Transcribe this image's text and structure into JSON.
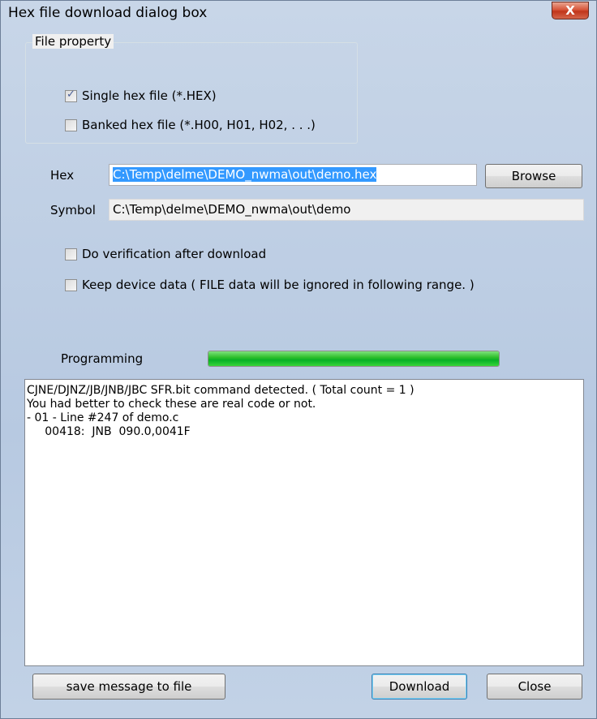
{
  "window": {
    "title": "Hex file download dialog box",
    "close_glyph": "X"
  },
  "file_property": {
    "group_label": "File property",
    "single_hex": {
      "label": "Single hex file (*.HEX)",
      "checked": true
    },
    "banked_hex": {
      "label": "Banked hex file (*.H00, H01, H02, . . .)",
      "checked": false
    }
  },
  "hex": {
    "label": "Hex",
    "value": "C:\\Temp\\delme\\DEMO_nwma\\out\\demo.hex",
    "browse_label": "Browse"
  },
  "symbol": {
    "label": "Symbol",
    "value": "C:\\Temp\\delme\\DEMO_nwma\\out\\demo"
  },
  "options": {
    "verify": {
      "label": "Do verification after download",
      "checked": false
    },
    "keep": {
      "label": "Keep device data ( FILE data will be ignored in following range. )",
      "checked": false
    }
  },
  "programming": {
    "label": "Programming",
    "progress": 1.0
  },
  "log": {
    "lines": [
      "CJNE/DJNZ/JB/JNB/JBC SFR.bit command detected. ( Total count = 1 )",
      "You had better to check these are real code or not.",
      "",
      "- 01 - Line #247 of demo.c",
      "     00418:  JNB  090.0,0041F"
    ]
  },
  "buttons": {
    "save": "save message to file",
    "download": "Download",
    "close": "Close"
  },
  "colors": {
    "progress": "#06b025",
    "selection": "#3399ff",
    "close_button": "#c0351a"
  }
}
